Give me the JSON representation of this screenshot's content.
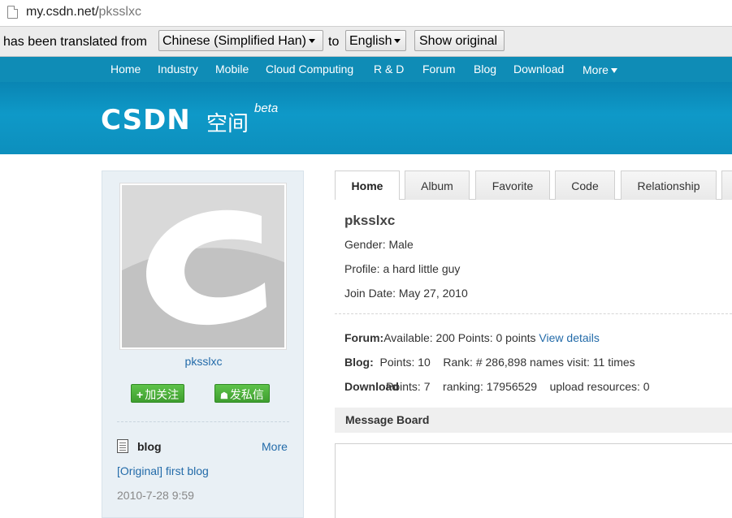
{
  "address_bar": {
    "domain": "my.csdn.net/",
    "path": "pksslxc"
  },
  "translate_bar": {
    "prefix": "has been translated from",
    "from_lang": "Chinese (Simplified Han)",
    "to_word": "to",
    "to_lang": "English",
    "show_original": "Show original"
  },
  "nav": {
    "items": [
      "Home",
      "Industry",
      "Mobile",
      "Cloud Computing",
      "R & D",
      "Forum",
      "Blog",
      "Download"
    ],
    "more": "More"
  },
  "logo": {
    "brand": "CSDN",
    "space": "空间",
    "beta": "beta"
  },
  "sidebar": {
    "username": "pksslxc",
    "follow_button": "加关注",
    "message_button": "发私信",
    "blog": {
      "title": "blog",
      "more": "More",
      "post_link": "[Original] first blog",
      "post_date": "2010-7-28 9:59"
    }
  },
  "tabs": [
    "Home",
    "Album",
    "Favorite",
    "Code",
    "Relationship"
  ],
  "profile": {
    "name": "pksslxc",
    "gender": "Gender: Male",
    "profile": "Profile: a hard little guy",
    "join_date": "Join Date: May 27, 2010"
  },
  "stats": {
    "forum_label": "Forum:",
    "forum_text": "Available: 200    Points: 0 points ",
    "forum_link": "View details",
    "blog_label": "Blog:",
    "blog_text": "  Points: 10    Rank: # 286,898 names visit: 11 times",
    "download_label": "Download",
    "download_text": "Points: 7    ranking: 17956529    upload resources: 0"
  },
  "message_board": {
    "title": "Message Board"
  },
  "colors": {
    "nav_bg": "#0f8cb6",
    "banner_bg": "#0e99c8",
    "link": "#236ba9",
    "green_button": "#4caf3a"
  }
}
